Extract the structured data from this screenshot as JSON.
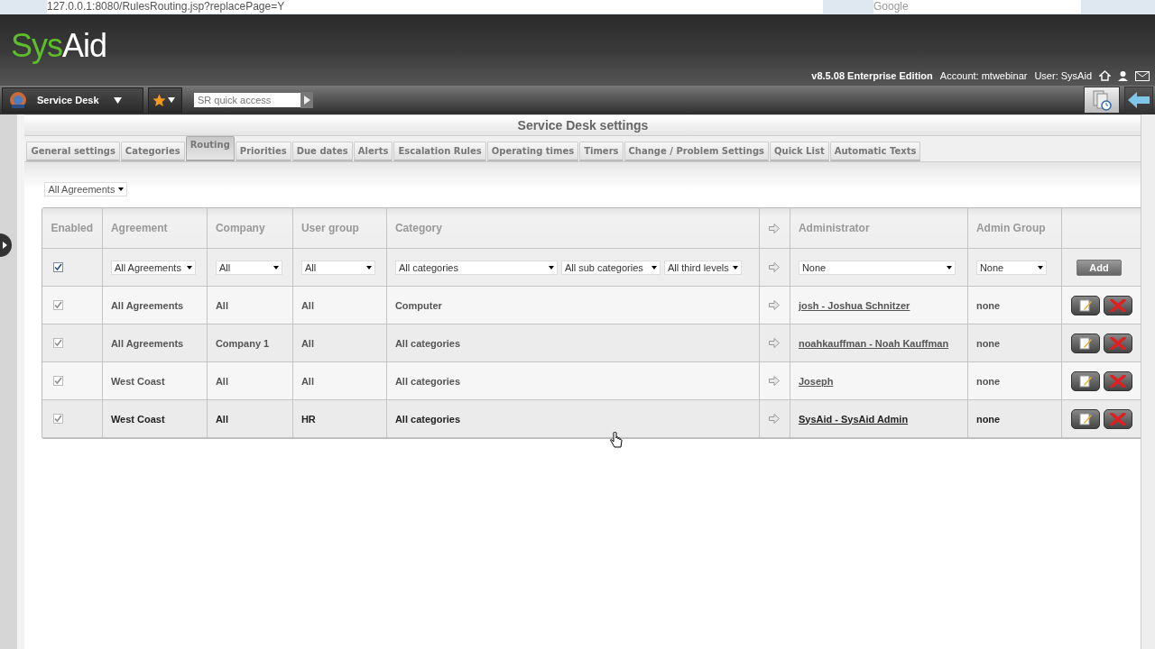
{
  "browser": {
    "url": "127.0.0.1:8080/RulesRouting.jsp?replacePage=Y",
    "search_placeholder": "Google"
  },
  "header": {
    "logo": {
      "green": "Sys",
      "white": "Aid"
    },
    "edition": "v8.5.08 Enterprise Edition",
    "account": "Account: mtwebinar",
    "user": "User: SysAid"
  },
  "toolbar": {
    "module": "Service Desk",
    "quick_access_placeholder": "SR quick access"
  },
  "page_title": "Service Desk settings",
  "tabs": [
    {
      "label": "General settings",
      "selected": false
    },
    {
      "label": "Categories",
      "selected": false
    },
    {
      "label": "Routing",
      "selected": true
    },
    {
      "label": "Priorities",
      "selected": false
    },
    {
      "label": "Due dates",
      "selected": false
    },
    {
      "label": "Alerts",
      "selected": false
    },
    {
      "label": "Escalation Rules",
      "selected": false
    },
    {
      "label": "Operating times",
      "selected": false
    },
    {
      "label": "Timers",
      "selected": false
    },
    {
      "label": "Change / Problem Settings",
      "selected": false
    },
    {
      "label": "Quick List",
      "selected": false
    },
    {
      "label": "Automatic Texts",
      "selected": false
    }
  ],
  "agreement_filter": "All Agreements",
  "table": {
    "columns": [
      "Enabled",
      "Agreement",
      "Company",
      "User group",
      "Category",
      "Administrator",
      "Admin Group"
    ],
    "new_rule": {
      "checked": true,
      "agreement": "All Agreements",
      "company": "All",
      "user_group": "All",
      "category": "All categories",
      "sub_category": "All sub categories",
      "third_level": "All third levels",
      "administrator": "None",
      "admin_group": "None",
      "add_button": "Add"
    },
    "rows": [
      {
        "enabled": true,
        "agreement": "All Agreements",
        "company": "All",
        "user_group": "All",
        "category": "Computer",
        "administrator": "josh - Joshua Schnitzer",
        "admin_group": "none",
        "hovered": false
      },
      {
        "enabled": true,
        "agreement": "All Agreements",
        "company": "Company 1",
        "user_group": "All",
        "category": "All categories",
        "administrator": "noahkauffman - Noah Kauffman",
        "admin_group": "none",
        "hovered": false
      },
      {
        "enabled": true,
        "agreement": "West Coast",
        "company": "All",
        "user_group": "All",
        "category": "All categories",
        "administrator": "Joseph",
        "admin_group": "none",
        "hovered": false
      },
      {
        "enabled": true,
        "agreement": "West Coast",
        "company": "All",
        "user_group": "HR",
        "category": "All categories",
        "administrator": "SysAid - SysAid Admin",
        "admin_group": "none",
        "hovered": true
      }
    ]
  }
}
